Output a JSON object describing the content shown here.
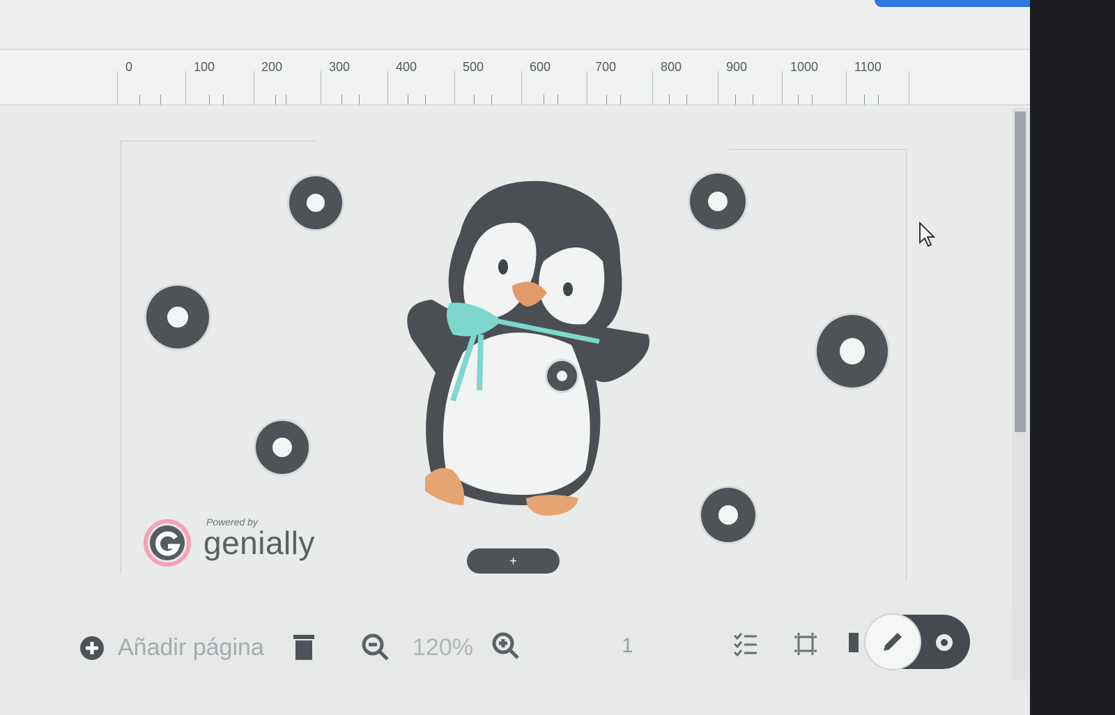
{
  "app": {
    "accent_color": "#2e76e0"
  },
  "ruler": {
    "labels": [
      "0",
      "100",
      "200",
      "300",
      "400",
      "500",
      "600",
      "700",
      "800",
      "900",
      "1000",
      "1100"
    ]
  },
  "canvas": {
    "hotspot_color": "#4f5357",
    "add_button_label": "+"
  },
  "branding": {
    "powered_by": "Powered by",
    "brand": "genially"
  },
  "toolbar": {
    "add_page_label": "Añadir página",
    "zoom_value": "120%",
    "page_number": "1",
    "icons": [
      "add-circle-icon",
      "trash-icon",
      "zoom-out-icon",
      "zoom-in-icon",
      "checklist-icon",
      "frame-icon",
      "edit-pencil-icon",
      "preview-eye-icon"
    ]
  }
}
